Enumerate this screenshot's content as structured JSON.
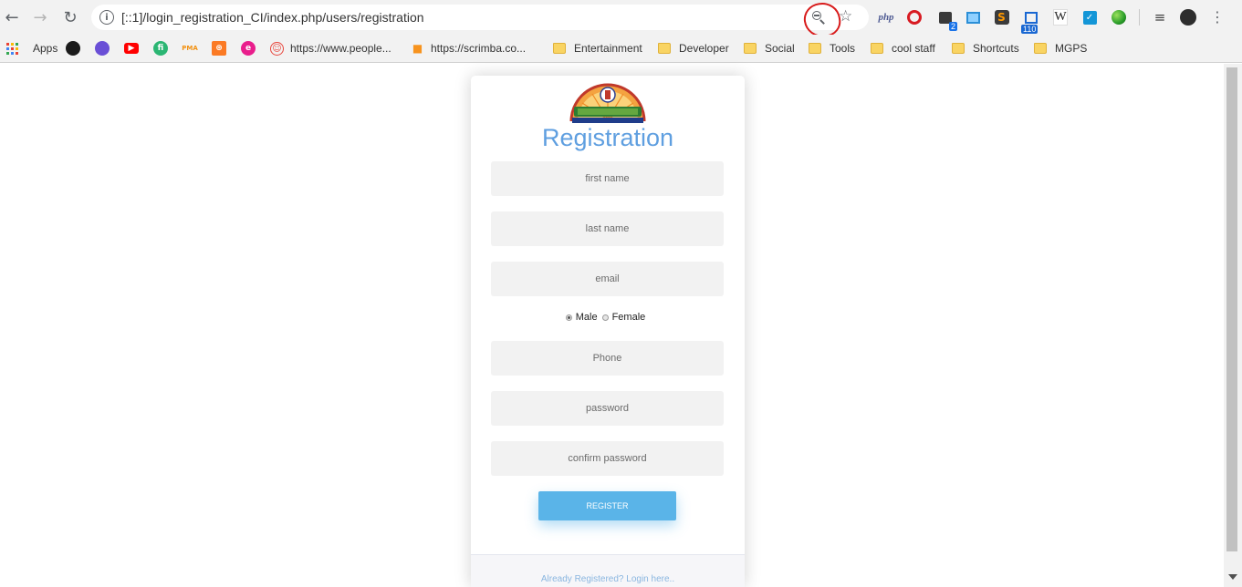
{
  "browser": {
    "url": "[::1]/login_registration_CI/index.php/users/registration",
    "extensions": {
      "php_label": "php",
      "box_badge": "2",
      "meter_badge": "110",
      "wiki_label": "W"
    }
  },
  "bookmarks": {
    "apps_label": "Apps",
    "people_label": "https://www.people...",
    "scrimba_label": "https://scrimba.co...",
    "folders": [
      "Entertainment",
      "Developer",
      "Social",
      "Tools",
      "cool staff",
      "Shortcuts",
      "MGPS"
    ]
  },
  "form": {
    "title": "Registration",
    "first_name_placeholder": "first name",
    "last_name_placeholder": "last name",
    "email_placeholder": "email",
    "gender_male": "Male",
    "gender_female": "Female",
    "gender_selected": "Male",
    "phone_placeholder": "Phone",
    "password_placeholder": "password",
    "confirm_password_placeholder": "confirm password",
    "register_label": "REGISTER",
    "login_link": "Already Registered? Login here.."
  },
  "colors": {
    "title": "#5f9fe0",
    "button": "#5ab4e8",
    "annotation": "#d81b1b",
    "link": "#8ab6e0"
  }
}
